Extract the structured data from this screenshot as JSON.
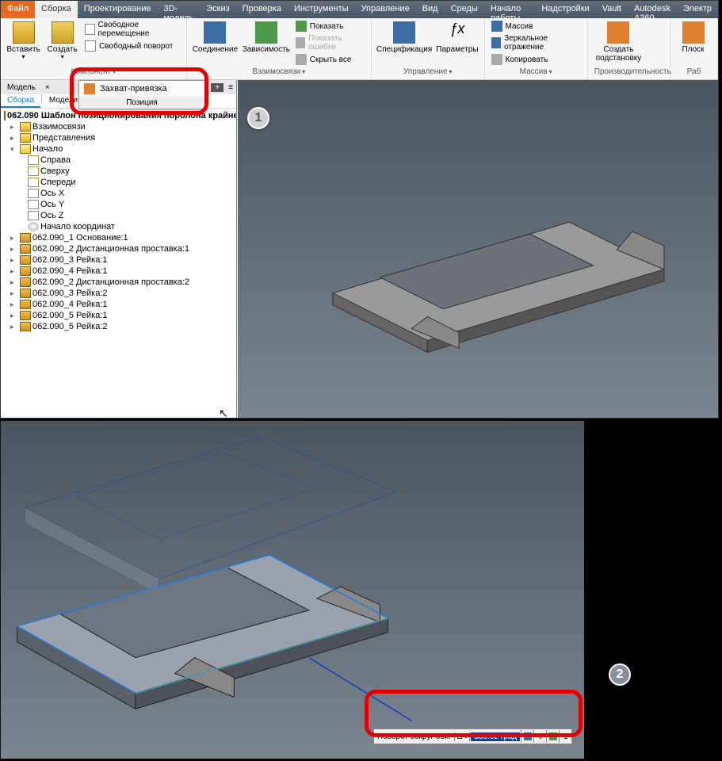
{
  "menubar": {
    "file": "Файл",
    "active": "Сборка",
    "items": [
      "Проектирование",
      "3D-модель",
      "Эскиз",
      "Проверка",
      "Инструменты",
      "Управление",
      "Вид",
      "Среды",
      "Начало работы",
      "Надстройки",
      "Vault",
      "Autodesk A360",
      "Электр"
    ]
  },
  "ribbon": {
    "component": {
      "insert": "Вставить",
      "create": "Создать",
      "free_move": "Свободное перемещение",
      "free_rotate": "Свободный поворот",
      "label": "Компонент"
    },
    "relations": {
      "joint": "Соединение",
      "constrain": "Зависимость",
      "show": "Показать",
      "show_errors": "Показать ошибки",
      "hide_all": "Скрыть все",
      "label": "Взаимосвязи"
    },
    "params": {
      "bom": "Спецификация",
      "params": "Параметры",
      "label": "Управление"
    },
    "pattern": {
      "pattern": "Массив",
      "mirror": "Зеркальное отражение",
      "copy": "Копировать",
      "label": "Массив"
    },
    "perf": {
      "create_sub": "Создать",
      "subst": "подстановку",
      "label": "Производительность"
    },
    "plane": {
      "plane": "Плоск",
      "label": "Раб"
    }
  },
  "popup": {
    "grab": "Захват-привязка",
    "group": "Позиция"
  },
  "panel": {
    "tab": "Модель",
    "subtabs": {
      "active": "Сборка",
      "other": "Модели"
    },
    "root": "062.090 Шаблон позиционирования поролона крайне",
    "nodes": {
      "rel": "Взаимосвязи",
      "repr": "Представления",
      "origin": "Начало",
      "right": "Справа",
      "top": "Сверху",
      "front": "Спереди",
      "axisX": "Ось X",
      "axisY": "Ось Y",
      "axisZ": "Ось Z",
      "origin_pt": "Начало координат"
    },
    "parts": [
      "062.090_1 Основание:1",
      "062.090_2 Дистанционная проставка:1",
      "062.090_3 Рейка:1",
      "062.090_4 Рейка:1",
      "062.090_2 Дистанционная проставка:2",
      "062.090_3 Рейка:2",
      "062.090_4 Рейка:1",
      "062.090_5 Рейка:1",
      "062.090_5 Рейка:2"
    ]
  },
  "rot_toolbar": {
    "label": "Поворот вокруг оси:",
    "delta": "Δ<",
    "value": "336.02 град",
    "count0": "0",
    "count1": "1"
  },
  "callouts": {
    "one": "1",
    "two": "2"
  }
}
